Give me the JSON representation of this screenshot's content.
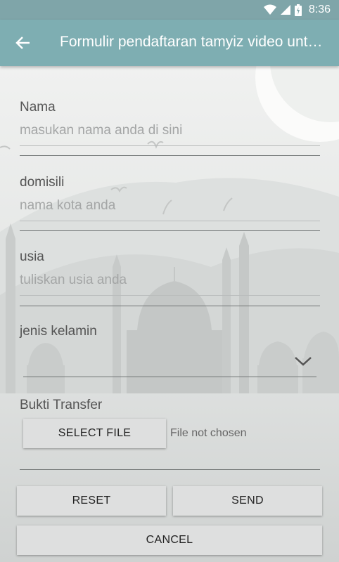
{
  "status_bar": {
    "time": "8:36"
  },
  "app_bar": {
    "title": "Formulir pendaftaran tamyiz video untuk anak-anak"
  },
  "form": {
    "nama": {
      "label": "Nama",
      "placeholder": "masukan nama anda di sini"
    },
    "domisili": {
      "label": "domisili",
      "placeholder": "nama kota anda"
    },
    "usia": {
      "label": "usia",
      "placeholder": "tuliskan usia anda"
    },
    "jenis_kelamin": {
      "label": "jenis kelamin",
      "selected": ""
    },
    "bukti_transfer": {
      "label": "Bukti Transfer",
      "select_button": "SELECT FILE",
      "file_status": "File not chosen"
    }
  },
  "actions": {
    "reset": "RESET",
    "send": "SEND",
    "cancel": "CANCEL"
  },
  "colors": {
    "app_bar": "#7eaeb2",
    "status_bar": "#7fa5a9",
    "background": "#d8dad9",
    "button": "#dedfdf"
  },
  "icons": [
    "wifi-icon",
    "signal-icon",
    "battery-icon",
    "back-arrow-icon",
    "chevron-down-icon"
  ]
}
